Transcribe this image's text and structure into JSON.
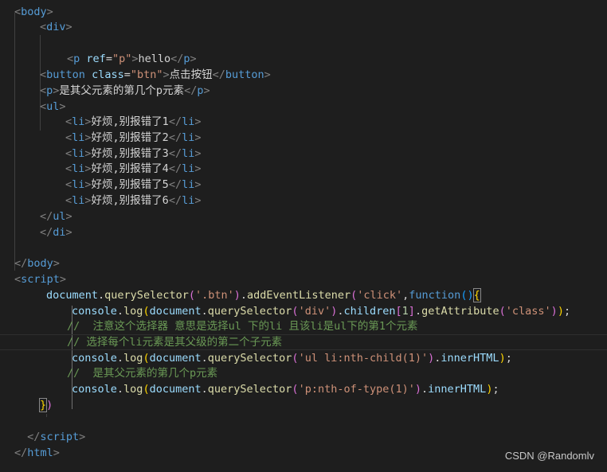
{
  "watermark": "CSDN @Randomlv",
  "lines": [
    {
      "indent": 0,
      "tokens": [
        [
          "<",
          "bracket"
        ],
        [
          "body",
          "tag"
        ],
        [
          ">",
          "bracket"
        ]
      ]
    },
    {
      "indent": 1,
      "tokens": [
        [
          "<",
          "bracket"
        ],
        [
          "div",
          "tag"
        ],
        [
          ">",
          "bracket"
        ]
      ]
    },
    {
      "indent": 1,
      "tokens": []
    },
    {
      "indent": 2,
      "tokens": [
        [
          "<",
          "bracket"
        ],
        [
          "p",
          "tag"
        ],
        [
          " ",
          "text"
        ],
        [
          "ref",
          "attr"
        ],
        [
          "=",
          "text"
        ],
        [
          "\"p\"",
          "str"
        ],
        [
          ">",
          "bracket"
        ],
        [
          "hello",
          "text"
        ],
        [
          "</",
          "bracket"
        ],
        [
          "p",
          "tag"
        ],
        [
          ">",
          "bracket"
        ]
      ]
    },
    {
      "indent": 1,
      "tokens": [
        [
          "<",
          "bracket"
        ],
        [
          "button",
          "tag"
        ],
        [
          " ",
          "text"
        ],
        [
          "class",
          "attr"
        ],
        [
          "=",
          "text"
        ],
        [
          "\"btn\"",
          "str"
        ],
        [
          ">",
          "bracket"
        ],
        [
          "点击按钮",
          "text"
        ],
        [
          "</",
          "bracket"
        ],
        [
          "button",
          "tag"
        ],
        [
          ">",
          "bracket"
        ]
      ]
    },
    {
      "indent": 1,
      "tokens": [
        [
          "<",
          "bracket"
        ],
        [
          "p",
          "tag"
        ],
        [
          ">",
          "bracket"
        ],
        [
          "是其父元素的第几个p元素",
          "text"
        ],
        [
          "</",
          "bracket"
        ],
        [
          "p",
          "tag"
        ],
        [
          ">",
          "bracket"
        ]
      ]
    },
    {
      "indent": 1,
      "tokens": [
        [
          "<",
          "bracket"
        ],
        [
          "ul",
          "tag"
        ],
        [
          ">",
          "bracket"
        ]
      ]
    },
    {
      "indent": 2,
      "tokens": [
        [
          "<",
          "bracket"
        ],
        [
          "li",
          "tag"
        ],
        [
          ">",
          "bracket"
        ],
        [
          "好烦,别报错了1",
          "text"
        ],
        [
          "</",
          "bracket"
        ],
        [
          "li",
          "tag"
        ],
        [
          ">",
          "bracket"
        ]
      ]
    },
    {
      "indent": 2,
      "tokens": [
        [
          "<",
          "bracket"
        ],
        [
          "li",
          "tag"
        ],
        [
          ">",
          "bracket"
        ],
        [
          "好烦,别报错了2",
          "text"
        ],
        [
          "</",
          "bracket"
        ],
        [
          "li",
          "tag"
        ],
        [
          ">",
          "bracket"
        ]
      ]
    },
    {
      "indent": 2,
      "tokens": [
        [
          "<",
          "bracket"
        ],
        [
          "li",
          "tag"
        ],
        [
          ">",
          "bracket"
        ],
        [
          "好烦,别报错了3",
          "text"
        ],
        [
          "</",
          "bracket"
        ],
        [
          "li",
          "tag"
        ],
        [
          ">",
          "bracket"
        ]
      ]
    },
    {
      "indent": 2,
      "tokens": [
        [
          "<",
          "bracket"
        ],
        [
          "li",
          "tag"
        ],
        [
          ">",
          "bracket"
        ],
        [
          "好烦,别报错了4",
          "text"
        ],
        [
          "</",
          "bracket"
        ],
        [
          "li",
          "tag"
        ],
        [
          ">",
          "bracket"
        ]
      ]
    },
    {
      "indent": 2,
      "tokens": [
        [
          "<",
          "bracket"
        ],
        [
          "li",
          "tag"
        ],
        [
          ">",
          "bracket"
        ],
        [
          "好烦,别报错了5",
          "text"
        ],
        [
          "</",
          "bracket"
        ],
        [
          "li",
          "tag"
        ],
        [
          ">",
          "bracket"
        ]
      ]
    },
    {
      "indent": 2,
      "tokens": [
        [
          "<",
          "bracket"
        ],
        [
          "li",
          "tag"
        ],
        [
          ">",
          "bracket"
        ],
        [
          "好烦,别报错了6",
          "text"
        ],
        [
          "</",
          "bracket"
        ],
        [
          "li",
          "tag"
        ],
        [
          ">",
          "bracket"
        ]
      ]
    },
    {
      "indent": 1,
      "tokens": [
        [
          "</",
          "bracket"
        ],
        [
          "ul",
          "tag"
        ],
        [
          ">",
          "bracket"
        ]
      ]
    },
    {
      "indent": 1,
      "tokens": [
        [
          "</",
          "bracket"
        ],
        [
          "di",
          "tag"
        ],
        [
          ">",
          "bracket"
        ]
      ]
    },
    {
      "indent": 0,
      "tokens": []
    },
    {
      "indent": 0,
      "tokens": [
        [
          "</",
          "bracket"
        ],
        [
          "body",
          "tag"
        ],
        [
          ">",
          "bracket"
        ]
      ]
    },
    {
      "indent": 0,
      "tokens": [
        [
          "<",
          "bracket"
        ],
        [
          "script",
          "tag"
        ],
        [
          ">",
          "bracket"
        ]
      ]
    },
    {
      "indent": 1,
      "tokens": [
        [
          "document",
          "var"
        ],
        [
          ".",
          "text"
        ],
        [
          "querySelector",
          "fn"
        ],
        [
          "(",
          "b2"
        ],
        [
          "'.btn'",
          "str"
        ],
        [
          ")",
          "b2"
        ],
        [
          ".",
          "text"
        ],
        [
          "addEventListener",
          "fn"
        ],
        [
          "(",
          "b2"
        ],
        [
          "'click'",
          "str"
        ],
        [
          ",",
          "text"
        ],
        [
          "function",
          "kw"
        ],
        [
          "()",
          "b3"
        ],
        [
          "{",
          "b1"
        ]
      ]
    },
    {
      "indent": 2,
      "tokens": [
        [
          "console",
          "var"
        ],
        [
          ".",
          "text"
        ],
        [
          "log",
          "fn"
        ],
        [
          "(",
          "b1"
        ],
        [
          "document",
          "var"
        ],
        [
          ".",
          "text"
        ],
        [
          "querySelector",
          "fn"
        ],
        [
          "(",
          "b2"
        ],
        [
          "'div'",
          "str"
        ],
        [
          ")",
          "b2"
        ],
        [
          ".",
          "text"
        ],
        [
          "children",
          "var"
        ],
        [
          "[",
          "b2"
        ],
        [
          "1",
          "num"
        ],
        [
          "]",
          "b2"
        ],
        [
          ".",
          "text"
        ],
        [
          "getAttribute",
          "fn"
        ],
        [
          "(",
          "b2"
        ],
        [
          "'class'",
          "str"
        ],
        [
          ")",
          "b2"
        ],
        [
          ")",
          "b1"
        ],
        [
          ";",
          "text"
        ]
      ]
    },
    {
      "indent": 2,
      "tokens": [
        [
          "//  注意这个选择器 意思是选择ul 下的li 且该li是ul下的第1个元素",
          "cmt"
        ]
      ]
    },
    {
      "indent": 2,
      "tokens": [
        [
          "// 选择每个li元素是其父级的第二个子元素",
          "cmt"
        ]
      ]
    },
    {
      "indent": 2,
      "tokens": [
        [
          "console",
          "var"
        ],
        [
          ".",
          "text"
        ],
        [
          "log",
          "fn"
        ],
        [
          "(",
          "b1"
        ],
        [
          "document",
          "var"
        ],
        [
          ".",
          "text"
        ],
        [
          "querySelector",
          "fn"
        ],
        [
          "(",
          "b2"
        ],
        [
          "'ul li:nth-child(1)'",
          "str"
        ],
        [
          ")",
          "b2"
        ],
        [
          ".",
          "text"
        ],
        [
          "innerHTML",
          "var"
        ],
        [
          ")",
          "b1"
        ],
        [
          ";",
          "text"
        ]
      ]
    },
    {
      "indent": 2,
      "tokens": [
        [
          "//  是其父元素的第几个p元素",
          "cmt"
        ]
      ]
    },
    {
      "indent": 2,
      "tokens": [
        [
          "console",
          "var"
        ],
        [
          ".",
          "text"
        ],
        [
          "log",
          "fn"
        ],
        [
          "(",
          "b1"
        ],
        [
          "document",
          "var"
        ],
        [
          ".",
          "text"
        ],
        [
          "querySelector",
          "fn"
        ],
        [
          "(",
          "b2"
        ],
        [
          "'p:nth-of-type(1)'",
          "str"
        ],
        [
          ")",
          "b2"
        ],
        [
          ".",
          "text"
        ],
        [
          "innerHTML",
          "var"
        ],
        [
          ")",
          "b1"
        ],
        [
          ";",
          "text"
        ]
      ]
    },
    {
      "indent": 1,
      "tokens": [
        [
          "}",
          "b1"
        ],
        [
          ")",
          "b2"
        ]
      ]
    },
    {
      "indent": 0,
      "tokens": []
    },
    {
      "indent": 0,
      "tokens": [
        [
          " </",
          "bracket"
        ],
        [
          "script",
          "tag"
        ],
        [
          ">",
          "bracket"
        ]
      ]
    },
    {
      "indent": 0,
      "tokens": [
        [
          "</",
          "bracket"
        ],
        [
          "html",
          "tag"
        ],
        [
          ">",
          "bracket"
        ]
      ]
    }
  ]
}
